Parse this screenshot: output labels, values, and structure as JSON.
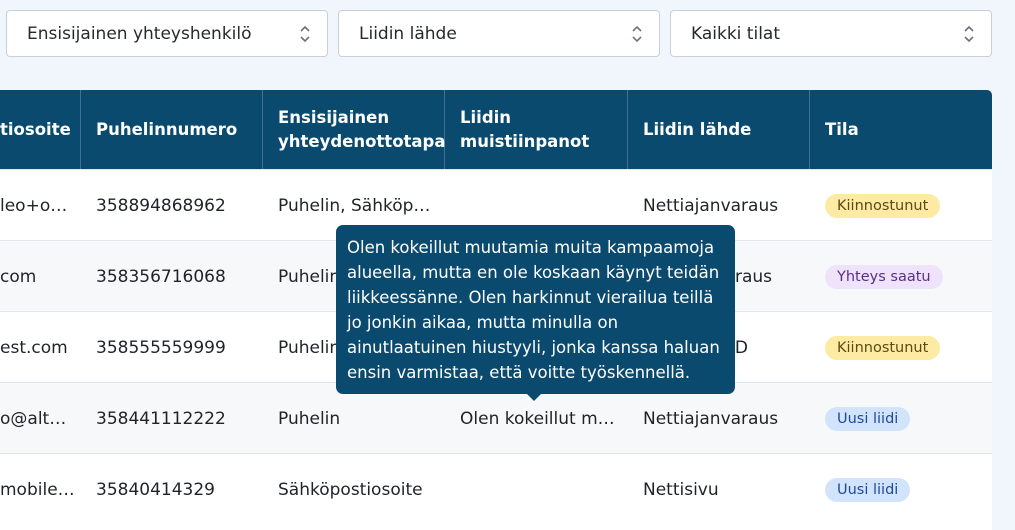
{
  "filters": {
    "primary_contact": "Ensisijainen yhteyshenkilö",
    "lead_source": "Liidin lähde",
    "status": "Kaikki tilat"
  },
  "table": {
    "columns": {
      "email": "tiosoite",
      "phone": "Puhelinnumero",
      "contact_method": "Ensisijainen yhteydenottotapa",
      "notes": "Liidin muistiinpanot",
      "source": "Liidin lähde",
      "status": "Tila"
    },
    "rows": [
      {
        "email": "leo+o…",
        "phone": "358894868962",
        "contact_method": "Puhelin, Sähköp…",
        "notes": "",
        "source": "Nettiajanvaraus",
        "status": "Kiinnostunut",
        "status_color": "#fdeaa3"
      },
      {
        "email": "com",
        "phone": "358356716068",
        "contact_method": "Puhelin",
        "notes": "",
        "source": "raus",
        "status": "Yhteys saatu",
        "status_color": "#efe3fb"
      },
      {
        "email": "est.com",
        "phone": "358555559999",
        "contact_method": "Puhelin",
        "notes": "",
        "source": "D",
        "status": "Kiinnostunut",
        "status_color": "#fdeaa3"
      },
      {
        "email": "o@alt…",
        "phone": "358441112222",
        "contact_method": "Puhelin",
        "notes": "Olen kokeillut m…",
        "source": "Nettiajanvaraus",
        "status": "Uusi liidi",
        "status_color": "#d2e4fc"
      },
      {
        "email": "mobile…",
        "phone": "35840414329",
        "contact_method": "Sähköpostiosoite",
        "notes": "",
        "source": "Nettisivu",
        "status": "Uusi liidi",
        "status_color": "#d2e4fc"
      }
    ]
  },
  "tooltip": {
    "text": "Olen kokeillut muutamia muita kampaamoja alueella, mutta en ole koskaan käynyt teidän liikkeessänne. Olen harkinnut vierailua teillä jo jonkin aikaa, mutta minulla on ainutlaatuinen hiustyyli, jonka kanssa haluan ensin varmistaa, että voitte työskennellä."
  },
  "colors": {
    "header_bg": "#0b4a6f",
    "page_bg": "#f1f6fd"
  }
}
